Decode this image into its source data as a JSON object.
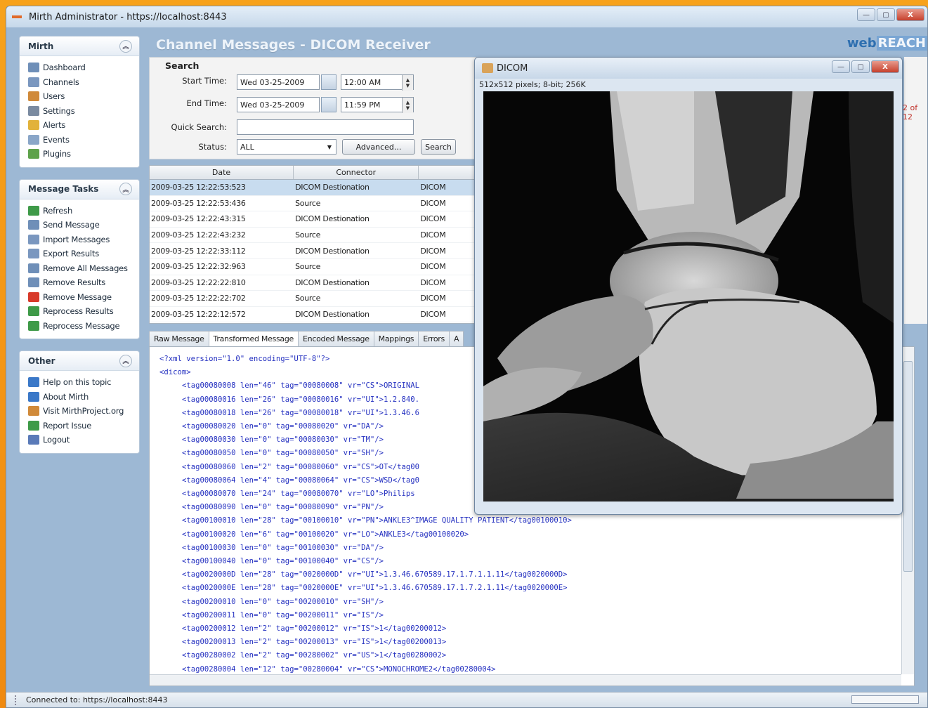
{
  "window": {
    "title": "Mirth Administrator - https://localhost:8443"
  },
  "header": {
    "title": "Channel Messages - DICOM Receiver",
    "brand_prefix": "web",
    "brand_suffix": "REACH"
  },
  "sidebar": {
    "mirth": {
      "title": "Mirth",
      "items": [
        {
          "label": "Dashboard",
          "icon": "dashboard-icon",
          "color": "#6f8fb8"
        },
        {
          "label": "Channels",
          "icon": "channels-icon",
          "color": "#7a97bf"
        },
        {
          "label": "Users",
          "icon": "users-icon",
          "color": "#d08a3a"
        },
        {
          "label": "Settings",
          "icon": "settings-icon",
          "color": "#7a8aa0"
        },
        {
          "label": "Alerts",
          "icon": "alerts-icon",
          "color": "#e2b23a"
        },
        {
          "label": "Events",
          "icon": "events-icon",
          "color": "#8aa6c8"
        },
        {
          "label": "Plugins",
          "icon": "plugins-icon",
          "color": "#5ea24a"
        }
      ]
    },
    "tasks": {
      "title": "Message Tasks",
      "items": [
        {
          "label": "Refresh",
          "icon": "refresh-icon",
          "color": "#3e9a48"
        },
        {
          "label": "Send Message",
          "icon": "send-message-icon",
          "color": "#6f8fb8"
        },
        {
          "label": "Import Messages",
          "icon": "import-messages-icon",
          "color": "#7a97bf"
        },
        {
          "label": "Export Results",
          "icon": "export-results-icon",
          "color": "#7a97bf"
        },
        {
          "label": "Remove All Messages",
          "icon": "remove-all-messages-icon",
          "color": "#6f8fb8"
        },
        {
          "label": "Remove Results",
          "icon": "remove-results-icon",
          "color": "#6f8fb8"
        },
        {
          "label": "Remove Message",
          "icon": "remove-message-icon",
          "color": "#d83a2a"
        },
        {
          "label": "Reprocess Results",
          "icon": "reprocess-results-icon",
          "color": "#3e9a48"
        },
        {
          "label": "Reprocess Message",
          "icon": "reprocess-message-icon",
          "color": "#3e9a48"
        }
      ]
    },
    "other": {
      "title": "Other",
      "items": [
        {
          "label": "Help on this topic",
          "icon": "help-icon",
          "color": "#3a78c8"
        },
        {
          "label": "About Mirth",
          "icon": "about-icon",
          "color": "#3a78c8"
        },
        {
          "label": "Visit MirthProject.org",
          "icon": "home-icon",
          "color": "#d08a3a"
        },
        {
          "label": "Report Issue",
          "icon": "report-issue-icon",
          "color": "#3e9a48"
        },
        {
          "label": "Logout",
          "icon": "logout-icon",
          "color": "#5a7ab8"
        }
      ]
    }
  },
  "search": {
    "label": "Search",
    "start_label": "Start Time:",
    "start_date": "Wed 03-25-2009",
    "start_time": "12:00 AM",
    "end_label": "End Time:",
    "end_date": "Wed 03-25-2009",
    "end_time": "11:59 PM",
    "quick_label": "Quick Search:",
    "quick_value": "",
    "status_label": "Status:",
    "status_value": "ALL",
    "advanced_label": "Advanced...",
    "search_label": "Search"
  },
  "table": {
    "columns": [
      "Date",
      "Connector",
      ""
    ],
    "rows": [
      [
        "2009-03-25 12:22:53:523",
        "DICOM Destionation",
        "DICOM"
      ],
      [
        "2009-03-25 12:22:53:436",
        "Source",
        "DICOM"
      ],
      [
        "2009-03-25 12:22:43:315",
        "DICOM Destionation",
        "DICOM"
      ],
      [
        "2009-03-25 12:22:43:232",
        "Source",
        "DICOM"
      ],
      [
        "2009-03-25 12:22:33:112",
        "DICOM Destionation",
        "DICOM"
      ],
      [
        "2009-03-25 12:22:32:963",
        "Source",
        "DICOM"
      ],
      [
        "2009-03-25 12:22:22:810",
        "DICOM Destionation",
        "DICOM"
      ],
      [
        "2009-03-25 12:22:22:702",
        "Source",
        "DICOM"
      ],
      [
        "2009-03-25 12:22:12:572",
        "DICOM Destionation",
        "DICOM"
      ]
    ],
    "page_info": "2 of 12"
  },
  "tabs": [
    "Raw Message",
    "Transformed Message",
    "Encoded Message",
    "Mappings",
    "Errors",
    "A"
  ],
  "xml": {
    "lines": [
      {
        "t": "<?xml version=\"1.0\" encoding=\"UTF-8\"?>",
        "indent": false
      },
      {
        "t": "<dicom>",
        "indent": false
      },
      {
        "t": "<tag00080008 len=\"46\" tag=\"00080008\" vr=\"CS\">ORIGINAL",
        "indent": true
      },
      {
        "t": "<tag00080016 len=\"26\" tag=\"00080016\" vr=\"UI\">1.2.840.",
        "indent": true
      },
      {
        "t": "<tag00080018 len=\"26\" tag=\"00080018\" vr=\"UI\">1.3.46.6",
        "indent": true
      },
      {
        "t": "<tag00080020 len=\"0\" tag=\"00080020\" vr=\"DA\"/>",
        "indent": true
      },
      {
        "t": "<tag00080030 len=\"0\" tag=\"00080030\" vr=\"TM\"/>",
        "indent": true
      },
      {
        "t": "<tag00080050 len=\"0\" tag=\"00080050\" vr=\"SH\"/>",
        "indent": true
      },
      {
        "t": "<tag00080060 len=\"2\" tag=\"00080060\" vr=\"CS\">OT</tag00",
        "indent": true
      },
      {
        "t": "<tag00080064 len=\"4\" tag=\"00080064\" vr=\"CS\">WSD</tag0",
        "indent": true
      },
      {
        "t": "<tag00080070 len=\"24\" tag=\"00080070\" vr=\"LO\">Philips",
        "indent": true
      },
      {
        "t": "<tag00080090 len=\"0\" tag=\"00080090\" vr=\"PN\"/>",
        "indent": true
      },
      {
        "t": "<tag00100010 len=\"28\" tag=\"00100010\" vr=\"PN\">ANKLE3^IMAGE QUALITY PATIENT</tag00100010>",
        "indent": true
      },
      {
        "t": "<tag00100020 len=\"6\" tag=\"00100020\" vr=\"LO\">ANKLE3</tag00100020>",
        "indent": true
      },
      {
        "t": "<tag00100030 len=\"0\" tag=\"00100030\" vr=\"DA\"/>",
        "indent": true
      },
      {
        "t": "<tag00100040 len=\"0\" tag=\"00100040\" vr=\"CS\"/>",
        "indent": true
      },
      {
        "t": "<tag0020000D len=\"28\" tag=\"0020000D\" vr=\"UI\">1.3.46.670589.17.1.7.1.1.11</tag0020000D>",
        "indent": true
      },
      {
        "t": "<tag0020000E len=\"28\" tag=\"0020000E\" vr=\"UI\">1.3.46.670589.17.1.7.2.1.11</tag0020000E>",
        "indent": true
      },
      {
        "t": "<tag00200010 len=\"0\" tag=\"00200010\" vr=\"SH\"/>",
        "indent": true
      },
      {
        "t": "<tag00200011 len=\"0\" tag=\"00200011\" vr=\"IS\"/>",
        "indent": true
      },
      {
        "t": "<tag00200012 len=\"2\" tag=\"00200012\" vr=\"IS\">1</tag00200012>",
        "indent": true
      },
      {
        "t": "<tag00200013 len=\"2\" tag=\"00200013\" vr=\"IS\">1</tag00200013>",
        "indent": true
      },
      {
        "t": "<tag00280002 len=\"2\" tag=\"00280002\" vr=\"US\">1</tag00280002>",
        "indent": true
      },
      {
        "t": "<tag00280004 len=\"12\" tag=\"00280004\" vr=\"CS\">MONOCHROME2</tag00280004>",
        "indent": true
      }
    ]
  },
  "dicom_window": {
    "title": "DICOM",
    "info": "512x512 pixels; 8-bit; 256K"
  },
  "status": {
    "text": "Connected to: https://localhost:8443"
  }
}
